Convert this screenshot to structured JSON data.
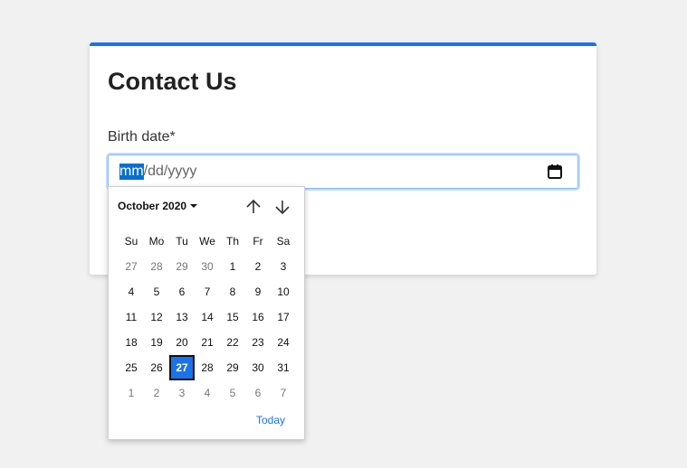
{
  "form": {
    "title": "Contact Us",
    "birth_label": "Birth date*",
    "date_input": {
      "segment_month": "mm",
      "separator_1": "/",
      "segment_day": "dd",
      "separator_2": "/",
      "segment_year": "yyyy"
    }
  },
  "picker": {
    "month_label": "October 2020",
    "weekdays": [
      "Su",
      "Mo",
      "Tu",
      "We",
      "Th",
      "Fr",
      "Sa"
    ],
    "weeks": [
      [
        "27",
        "28",
        "29",
        "30",
        "1",
        "2",
        "3"
      ],
      [
        "4",
        "5",
        "6",
        "7",
        "8",
        "9",
        "10"
      ],
      [
        "11",
        "12",
        "13",
        "14",
        "15",
        "16",
        "17"
      ],
      [
        "18",
        "19",
        "20",
        "21",
        "22",
        "23",
        "24"
      ],
      [
        "25",
        "26",
        "27",
        "28",
        "29",
        "30",
        "31"
      ],
      [
        "1",
        "2",
        "3",
        "4",
        "5",
        "6",
        "7"
      ]
    ],
    "muted_first_week_count": 4,
    "muted_last_week_count": 7,
    "selected_day": "27",
    "today_label": "Today"
  }
}
